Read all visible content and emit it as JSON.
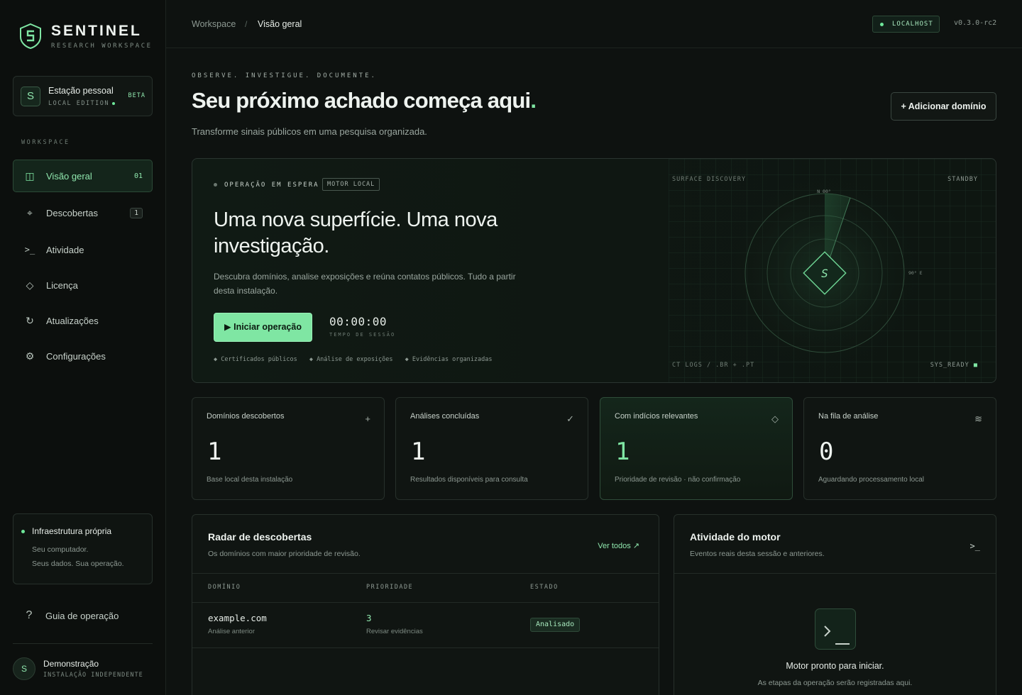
{
  "brand": {
    "name": "SENTINEL",
    "sub": "RESEARCH WORKSPACE"
  },
  "station": {
    "badge": "S",
    "title": "Estação pessoal",
    "sub": "LOCAL EDITION",
    "beta": "BETA"
  },
  "sidebar": {
    "section_label": "WORKSPACE",
    "items": [
      {
        "label": "Visão geral",
        "icon": "grid-icon",
        "count": "01",
        "active": true
      },
      {
        "label": "Descobertas",
        "icon": "crosshair-icon",
        "count": "1"
      },
      {
        "label": "Atividade",
        "icon": "terminal-icon"
      },
      {
        "label": "Licença",
        "icon": "diamond-icon"
      },
      {
        "label": "Atualizações",
        "icon": "refresh-icon"
      },
      {
        "label": "Configurações",
        "icon": "gear-icon"
      }
    ],
    "infra": {
      "title": "Infraestrutura própria",
      "line1": "Seu computador.",
      "line2": "Seus dados. Sua operação."
    },
    "guide": {
      "label": "Guia de operação",
      "icon": "help-icon"
    },
    "user": {
      "initial": "S",
      "name": "Demonstração",
      "sub": "INSTALAÇÃO INDEPENDENTE"
    }
  },
  "topbar": {
    "breadcrumb": [
      "Workspace",
      "Visão geral"
    ],
    "separator": "/",
    "host": "LOCALHOST",
    "version": "v0.3.0-rc2"
  },
  "header": {
    "eyebrow": "OBSERVE. INVESTIGUE. DOCUMENTE.",
    "title": "Seu próximo achado começa aqui",
    "title_accent": ".",
    "subtitle": "Transforme sinais públicos em uma pesquisa organizada.",
    "add_button": "+ Adicionar domínio"
  },
  "hero": {
    "status": "OPERAÇÃO EM ESPERA",
    "engine_tag": "MOTOR LOCAL",
    "title": "Uma nova superfície. Uma nova investigação.",
    "description": "Descubra domínios, analise exposições e reúna contatos públicos. Tudo a partir desta instalação.",
    "start_button": "▶ Iniciar operação",
    "timer": "00:00:00",
    "timer_label": "TEMPO DE SESSÃO",
    "features": [
      "◆ Certificados públicos",
      "◆ Análise de exposições",
      "◆ Evidências organizadas"
    ],
    "radar": {
      "label_tl": "SURFACE DISCOVERY",
      "label_tr": "STANDBY",
      "label_bl": "CT LOGS / .BR + .PT",
      "label_br": "SYS_READY",
      "north": "N 00°",
      "east": "90° E",
      "center_glyph": "S"
    }
  },
  "stats": [
    {
      "title": "Domínios descobertos",
      "icon": "plus-icon",
      "glyph": "+",
      "value": "1",
      "foot": "Base local desta instalação"
    },
    {
      "title": "Análises concluídas",
      "icon": "check-icon",
      "glyph": "✓",
      "value": "1",
      "foot": "Resultados disponíveis para consulta"
    },
    {
      "title": "Com indícios relevantes",
      "icon": "diamond-icon",
      "glyph": "◇",
      "value": "1",
      "foot": "Prioridade de revisão · não confirmação"
    },
    {
      "title": "Na fila de análise",
      "icon": "waves-icon",
      "glyph": "≋",
      "value": "0",
      "foot": "Aguardando processamento local"
    }
  ],
  "discoveries": {
    "title": "Radar de descobertas",
    "subtitle": "Os domínios com maior prioridade de revisão.",
    "view_all": "Ver todos ↗",
    "columns": [
      "DOMÍNIO",
      "PRIORIDADE",
      "ESTADO"
    ],
    "rows": [
      {
        "domain": "example.com",
        "domain_sub": "Análise anterior",
        "priority": "3",
        "priority_sub": "Revisar evidências",
        "state": "Analisado"
      }
    ]
  },
  "engine": {
    "title": "Atividade do motor",
    "subtitle": "Eventos reais desta sessão e anteriores.",
    "ready": "Motor pronto para iniciar.",
    "ready_sub": "As etapas da operação serão registradas aqui."
  },
  "colors": {
    "accent": "#7fe6a3",
    "bg": "#0e1210"
  }
}
